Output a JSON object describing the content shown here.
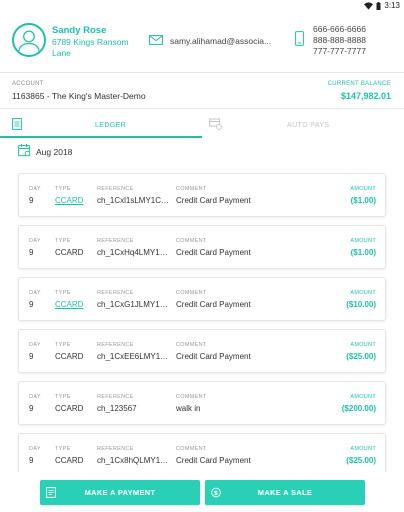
{
  "status_bar": {
    "time": "3:13",
    "icons": [
      "wifi-icon",
      "battery-icon"
    ]
  },
  "customer": {
    "name": "Sandy Rose",
    "address": "6789 Kings Ransom Lane",
    "email": "samy.alihamad@associa...",
    "phones": [
      "666-666-6666",
      "888-888-8888",
      "777-777-7777"
    ]
  },
  "account": {
    "label": "ACCOUNT",
    "value": "1163865 - The King's Master-Demo",
    "balance_label": "CURRENT BALANCE",
    "balance_value": "$147,982.01"
  },
  "tabs": [
    {
      "label": "LEDGER",
      "active": true,
      "icon": "ledger-icon"
    },
    {
      "label": "AUTO PAYS",
      "active": false,
      "icon": "autopay-icon"
    }
  ],
  "period": "Aug 2018",
  "columns": {
    "day": "DAY",
    "type": "TYPE",
    "reference": "REFERENCE",
    "comment": "COMMENT",
    "amount": "AMOUNT"
  },
  "transactions": [
    {
      "day": "9",
      "type": "CCARD",
      "type_link": true,
      "reference": "ch_1Cxl1sLMY1CO...",
      "comment": "Credit Card Payment",
      "amount": "($1.00)"
    },
    {
      "day": "9",
      "type": "CCARD",
      "type_link": false,
      "reference": "ch_1CxHq4LMY1CO...",
      "comment": "Credit Card Payment",
      "amount": "($1.00)"
    },
    {
      "day": "9",
      "type": "CCARD",
      "type_link": true,
      "reference": "ch_1CxG1JLMY1CO...",
      "comment": "Credit Card Payment",
      "amount": "($10.00)"
    },
    {
      "day": "9",
      "type": "CCARD",
      "type_link": false,
      "reference": "ch_1CxEE6LMY1CO...",
      "comment": "Credit Card Payment",
      "amount": "($25.00)"
    },
    {
      "day": "9",
      "type": "CCARD",
      "type_link": false,
      "reference": "ch_123567",
      "comment": "walk in",
      "amount": "($200.00)"
    },
    {
      "day": "9",
      "type": "CCARD",
      "type_link": false,
      "reference": "ch_1Cx8hQLMY1CO...",
      "comment": "Credit Card Payment",
      "amount": "($25.00)"
    }
  ],
  "actions": {
    "payment": "MAKE A PAYMENT",
    "sale": "MAKE A SALE"
  },
  "colors": {
    "accent": "#1fbfa9",
    "button": "#2ad0b5",
    "inactive_tab": "#c4c4c4"
  }
}
